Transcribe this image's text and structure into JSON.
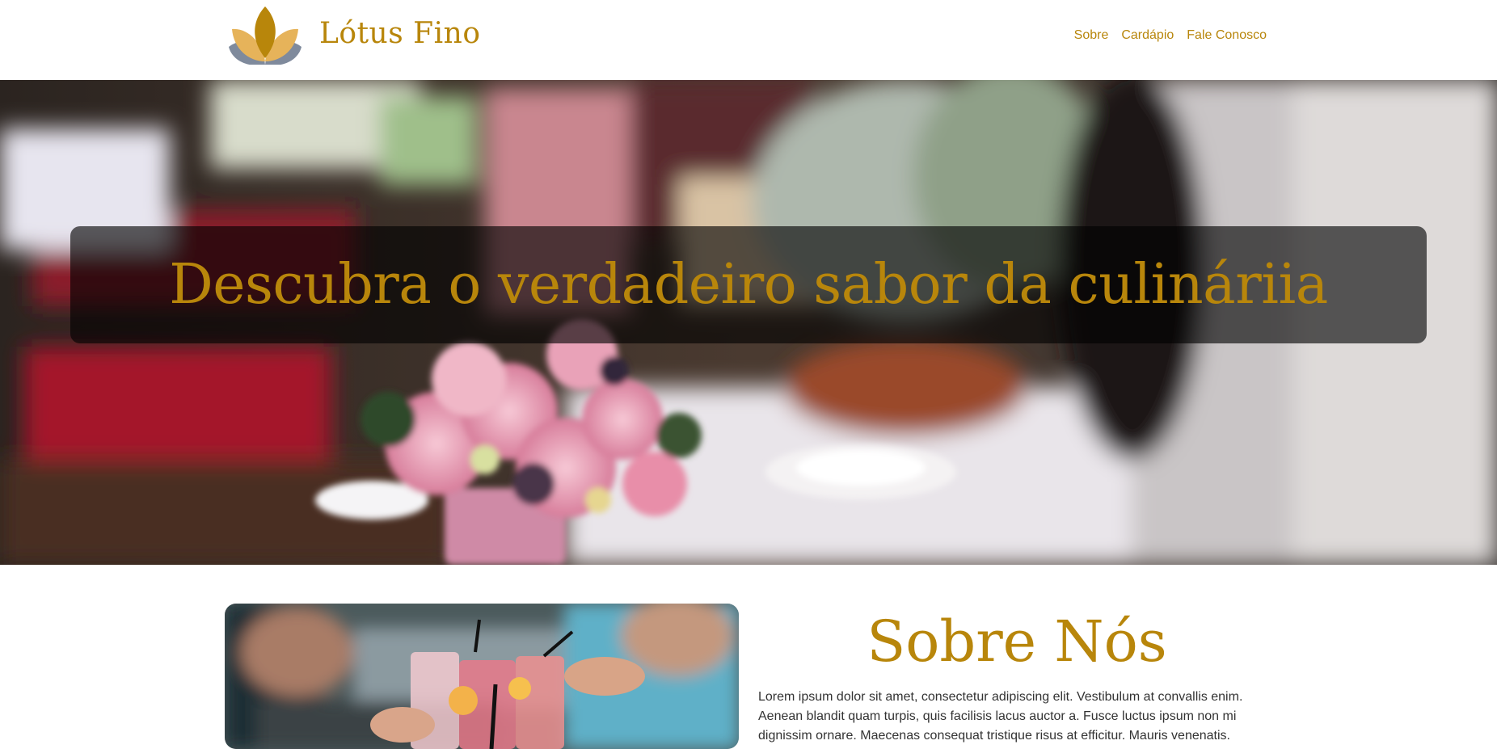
{
  "brand": {
    "name": "Lótus Fino",
    "logo_icon": "lotus-icon",
    "color": "#b8860b"
  },
  "nav": [
    {
      "label": "Sobre"
    },
    {
      "label": "Cardápio"
    },
    {
      "label": "Fale Conosco"
    }
  ],
  "hero": {
    "title": "Descubra o verdadeiro sabor da culináriia"
  },
  "about": {
    "title": "Sobre Nós",
    "text": "Lorem ipsum dolor sit amet, consectetur adipiscing elit. Vestibulum at convallis enim. Aenean blandit quam turpis, quis facilisis lacus auctor a. Fusce luctus ipsum non mi dignissim ornare. Maecenas consequat tristique risus at efficitur. Mauris venenatis."
  },
  "colors": {
    "accent": "#b8860b",
    "lotus_gold": "#e6b35a",
    "lotus_slate": "#7f8a9c"
  }
}
